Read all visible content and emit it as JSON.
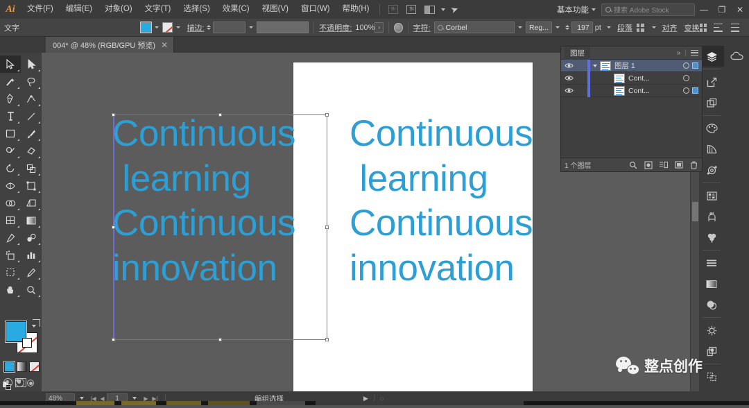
{
  "app": {
    "logo": "Ai",
    "menus": [
      {
        "label": "文件(F)"
      },
      {
        "label": "编辑(E)"
      },
      {
        "label": "对象(O)"
      },
      {
        "label": "文字(T)"
      },
      {
        "label": "选择(S)"
      },
      {
        "label": "效果(C)"
      },
      {
        "label": "视图(V)"
      },
      {
        "label": "窗口(W)"
      },
      {
        "label": "帮助(H)"
      }
    ],
    "bridge_icon": "bridge-icon",
    "stock_icon": "stock-icon",
    "arrange_icon": "arrange-documents-icon",
    "rocket_icon": "rocket-icon",
    "workspace": "基本功能",
    "search_placeholder": "搜索 Adobe Stock",
    "window_controls": {
      "minimize": "—",
      "restore": "❐",
      "close": "✕"
    }
  },
  "control_bar": {
    "object_type": "文字",
    "fill_color": "#29abe2",
    "stroke_color": "无",
    "stroke_label": "描边:",
    "stroke_weight": "",
    "brush_value": "",
    "opacity_label": "不透明度:",
    "opacity_value": "100%",
    "character_label": "字符:",
    "font_family": "Corbel",
    "font_style": "Reg...",
    "font_size": "197",
    "font_size_unit": "pt",
    "paragraph_label": "段落",
    "align_label": "对齐",
    "transform_label": "变换"
  },
  "tabs": {
    "documents": [
      {
        "title": "004* @ 48% (RGB/GPU 预览)",
        "close": "✕",
        "active": true
      }
    ]
  },
  "toolbar": {
    "tools": [
      {
        "name": "selection-tool",
        "active": true
      },
      {
        "name": "direct-selection-tool",
        "active": false
      },
      {
        "name": "magic-wand-tool",
        "active": false
      },
      {
        "name": "lasso-tool",
        "active": false
      },
      {
        "name": "pen-tool",
        "active": false
      },
      {
        "name": "curvature-tool",
        "active": false
      },
      {
        "name": "type-tool",
        "active": false
      },
      {
        "name": "line-segment-tool",
        "active": false
      },
      {
        "name": "rectangle-tool",
        "active": false
      },
      {
        "name": "paintbrush-tool",
        "active": false
      },
      {
        "name": "shaper-tool",
        "active": false
      },
      {
        "name": "eraser-tool",
        "active": false
      },
      {
        "name": "rotate-tool",
        "active": false
      },
      {
        "name": "scale-tool",
        "active": false
      },
      {
        "name": "width-tool",
        "active": false
      },
      {
        "name": "free-transform-tool",
        "active": false
      },
      {
        "name": "shape-builder-tool",
        "active": false
      },
      {
        "name": "perspective-grid-tool",
        "active": false
      },
      {
        "name": "mesh-tool",
        "active": false
      },
      {
        "name": "gradient-tool",
        "active": false
      },
      {
        "name": "eyedropper-tool",
        "active": false
      },
      {
        "name": "blend-tool",
        "active": false
      },
      {
        "name": "symbol-sprayer-tool",
        "active": false
      },
      {
        "name": "column-graph-tool",
        "active": false
      },
      {
        "name": "artboard-tool",
        "active": false
      },
      {
        "name": "slice-tool",
        "active": false
      },
      {
        "name": "hand-tool",
        "active": false
      },
      {
        "name": "zoom-tool",
        "active": false
      }
    ],
    "fill_color": "#29abe2",
    "stroke_color": "#ffffff",
    "stroke_none": true,
    "color_modes": [
      "color-mode",
      "gradient-mode",
      "none-mode"
    ],
    "draw_modes": [
      "draw-normal",
      "draw-behind",
      "draw-inside"
    ],
    "screen_mode": "screen-mode-icon"
  },
  "canvas": {
    "artboard_color": "#ffffff",
    "text_color": "#2e9fd4",
    "text_lines": [
      "Continuous",
      " learning",
      "Continuous",
      "innovation"
    ],
    "text_block_left": "Continuous\n learning\nContinuous\ninnovation",
    "text_block_right": "Continuous\n learning\nContinuous\ninnovation",
    "selection_color": "#6e6ed8",
    "selected": true
  },
  "layers_panel": {
    "title": "图层",
    "collapse_icon": "chevron-double-right-icon",
    "menu_icon": "panel-menu-icon",
    "rows": [
      {
        "name": "图层 1",
        "selected": true,
        "visible": true,
        "expanded": true,
        "target_selected": true,
        "depth": 0
      },
      {
        "name": "Cont...",
        "selected": false,
        "visible": true,
        "expanded": false,
        "target_selected": false,
        "depth": 1
      },
      {
        "name": "Cont...",
        "selected": false,
        "visible": true,
        "expanded": false,
        "target_selected": true,
        "depth": 1
      }
    ],
    "footer_count": "1 个图层",
    "footer_icons": [
      "locate-object-icon",
      "make-mask-icon",
      "new-sublayer-icon",
      "new-layer-icon",
      "delete-layer-icon"
    ]
  },
  "right_dock": {
    "buttons": [
      {
        "name": "layers-panel-icon",
        "selected": true
      },
      {
        "name": "libraries-panel-icon",
        "selected": false
      },
      {
        "name": "export-panel-icon",
        "selected": false
      },
      {
        "name": "artboards-panel-icon",
        "selected": false
      },
      {
        "name": "color-panel-icon",
        "selected": false
      },
      {
        "name": "color-guide-panel-icon",
        "selected": false
      },
      {
        "name": "swatches-panel-icon",
        "selected": false
      },
      {
        "name": "image-trace-panel-icon",
        "selected": false
      },
      {
        "name": "brushes-panel-icon",
        "selected": false
      },
      {
        "name": "symbols-panel-icon",
        "selected": false
      },
      {
        "name": "align-panel-icon",
        "selected": false
      },
      {
        "name": "gradient-panel-icon",
        "selected": false
      },
      {
        "name": "transparency-panel-icon",
        "selected": false
      },
      {
        "name": "appearance-panel-icon",
        "selected": false
      },
      {
        "name": "graphic-styles-panel-icon",
        "selected": false
      },
      {
        "name": "pathfinder-panel-icon",
        "selected": false
      },
      {
        "name": "transform-panel-icon",
        "selected": false
      }
    ]
  },
  "status_bar": {
    "zoom": "48%",
    "page": "1",
    "tool_status": "编组选择",
    "prev_icon": "◀",
    "next_icon": "▶"
  },
  "watermark": {
    "text": "整点创作",
    "icon": "wechat-icon"
  }
}
